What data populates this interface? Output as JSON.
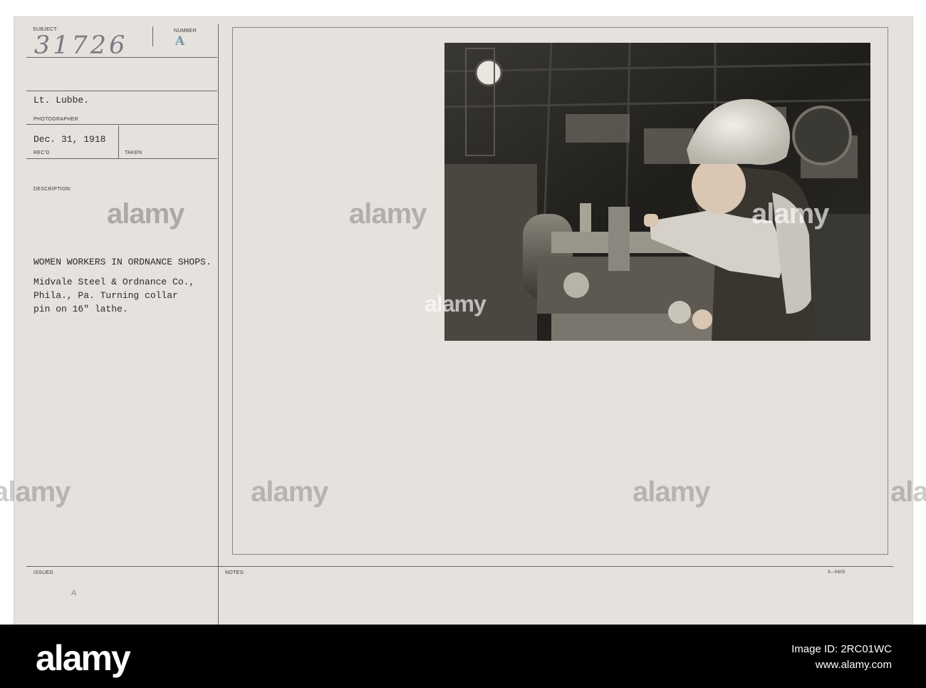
{
  "card": {
    "subject_label": "SUBJECT:",
    "subject_number": "31726",
    "number_label": "NUMBER",
    "number_value": "A",
    "photographer_name": "Lt. Lubbe.",
    "photographer_label": "PHOTOGRAPHER",
    "date": "Dec. 31, 1918",
    "recd_label": "REC'D",
    "taken_label": "TAKEN",
    "description_label": "DESCRIPTION:",
    "description_title": "WOMEN WORKERS IN ORDNANCE SHOPS.",
    "description_body": "Midvale Steel & Ordnance Co.,\nPhila., Pa. Turning collar\npin on 16\" lathe.",
    "issued_label": "ISSUED",
    "notes_label": "NOTES:",
    "form_number": "3—5605",
    "issued_mark": "A",
    "photo_negative_number": "31726"
  },
  "watermark": "alamy",
  "footer": {
    "logo": "alamy",
    "image_id_label": "Image ID: 2RC01WC",
    "url": "www.alamy.com"
  }
}
